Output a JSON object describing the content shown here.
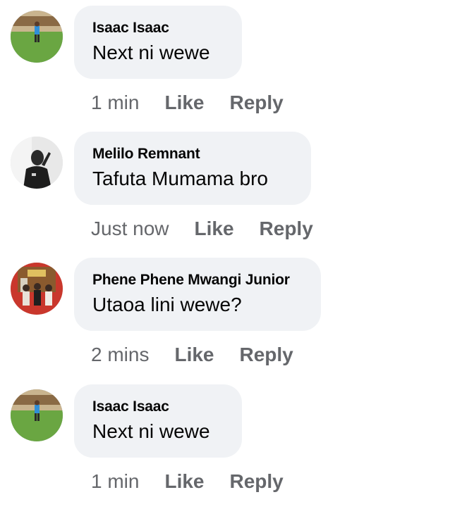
{
  "comments": [
    {
      "author": "Isaac Isaac",
      "text": "Next ni wewe",
      "time": "1 min",
      "like_label": "Like",
      "reply_label": "Reply"
    },
    {
      "author": "Melilo Remnant",
      "text": "Tafuta Mumama bro",
      "time": "Just now",
      "like_label": "Like",
      "reply_label": "Reply"
    },
    {
      "author": "Phene Phene Mwangi Junior",
      "text": "Utaoa lini wewe?",
      "time": "2 mins",
      "like_label": "Like",
      "reply_label": "Reply"
    },
    {
      "author": "Isaac Isaac",
      "text": "Next ni wewe",
      "time": "1 min",
      "like_label": "Like",
      "reply_label": "Reply"
    }
  ]
}
